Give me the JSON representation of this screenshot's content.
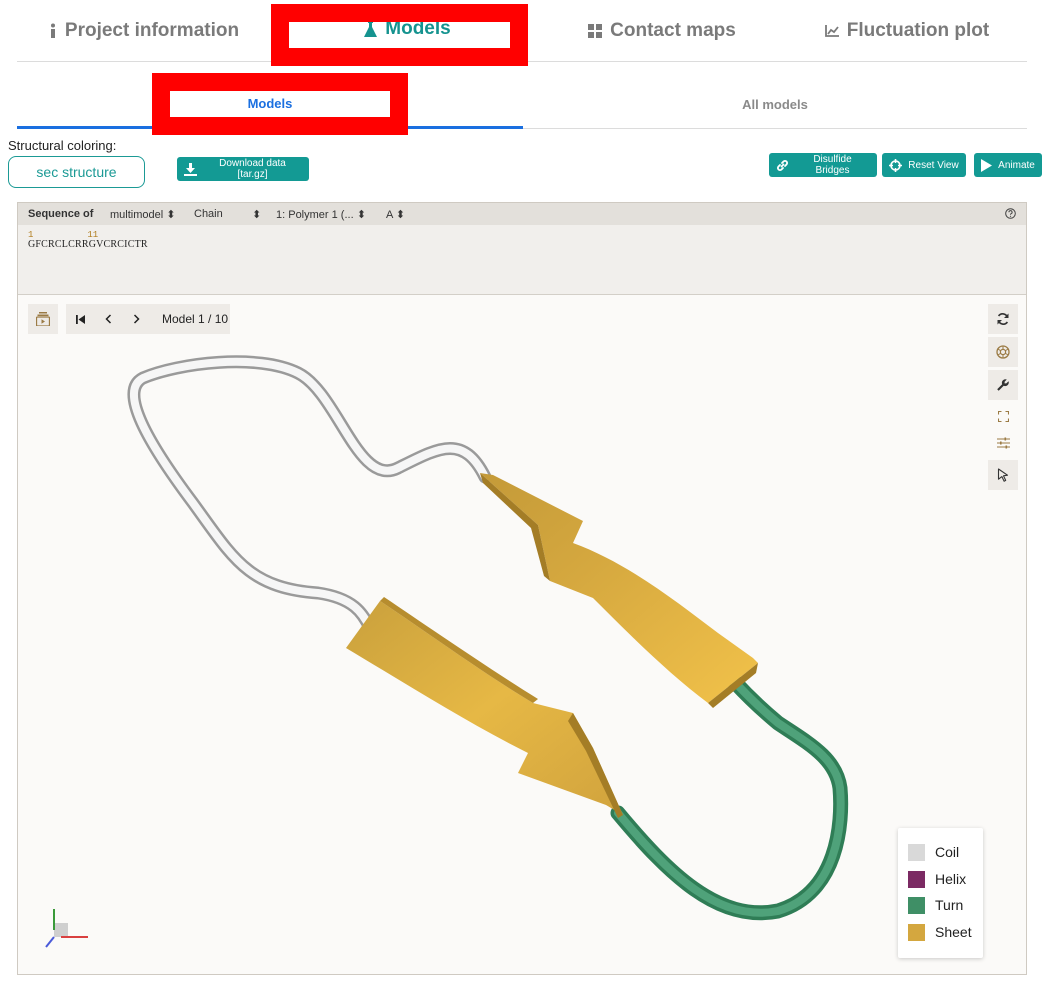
{
  "top_tabs": [
    {
      "label": "Project information",
      "icon": "info-icon"
    },
    {
      "label": "Models",
      "icon": "flask-icon",
      "active": true
    },
    {
      "label": "Contact maps",
      "icon": "grid-icon"
    },
    {
      "label": "Fluctuation plot",
      "icon": "chart-line-icon"
    }
  ],
  "sub_tabs": [
    {
      "label": "Models",
      "active": true
    },
    {
      "label": "All models"
    }
  ],
  "toolbar": {
    "coloring_label": "Structural coloring:",
    "sec_structure_label": "sec structure",
    "download_label": "Download data [tar.gz]",
    "disulfide_label": "Disulfide Bridges",
    "reset_label": "Reset View",
    "animate_label": "Animate"
  },
  "sequence_panel": {
    "sequence_of_label": "Sequence of",
    "entity_select": "multimodel",
    "chain_select": "Chain",
    "polymer_select": "1: Polymer 1 (...",
    "chain_id_select": "A",
    "numbers": "1          11",
    "sequence": "GFCRCLCRRGVCRCICTR"
  },
  "viewer": {
    "model_label": "Model 1 / 10"
  },
  "legend": [
    {
      "label": "Coil",
      "color": "#d9d9d9"
    },
    {
      "label": "Helix",
      "color": "#7b2a63"
    },
    {
      "label": "Turn",
      "color": "#3f8f66"
    },
    {
      "label": "Sheet",
      "color": "#d4a73f"
    }
  ],
  "colors": {
    "accent": "#15938f",
    "link_blue": "#1a6fe0",
    "highlight": "#ff0000"
  }
}
